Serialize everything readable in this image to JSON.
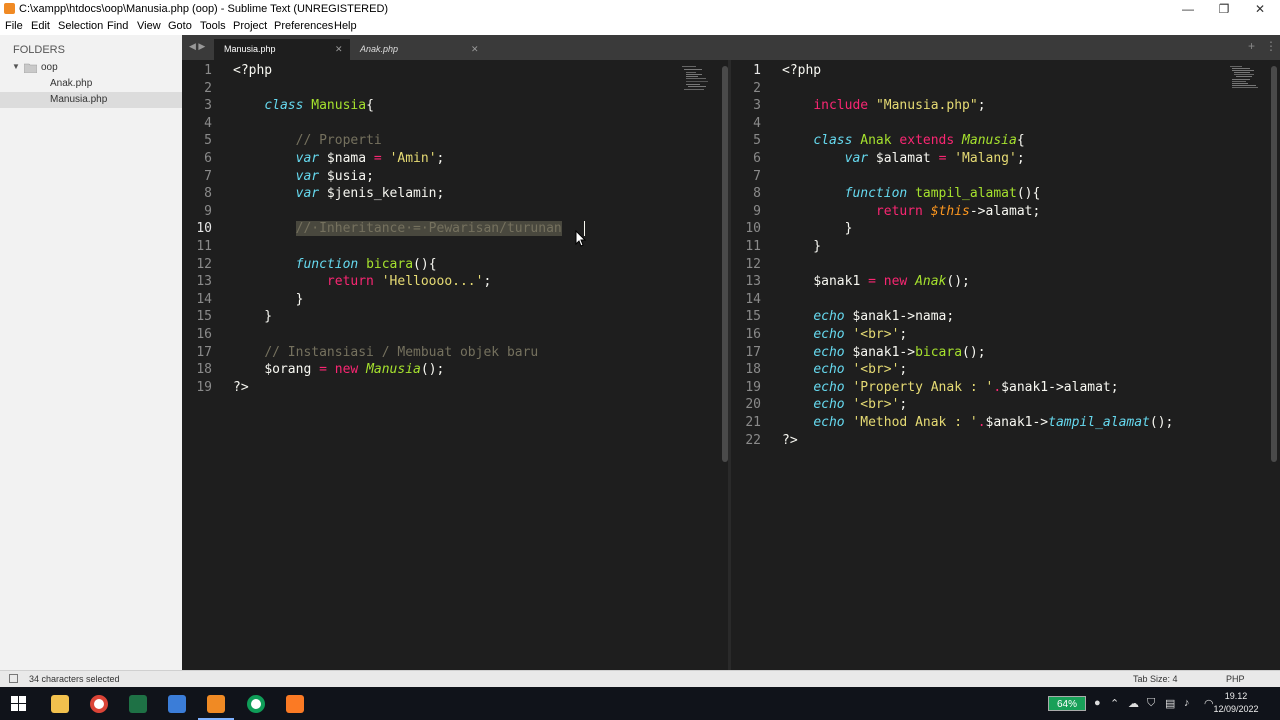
{
  "window": {
    "title": "C:\\xampp\\htdocs\\oop\\Manusia.php (oop) - Sublime Text (UNREGISTERED)",
    "controls": {
      "minimize": "—",
      "restore": "❐",
      "close": "✕"
    }
  },
  "menu": [
    "File",
    "Edit",
    "Selection",
    "Find",
    "View",
    "Goto",
    "Tools",
    "Project",
    "Preferences",
    "Help"
  ],
  "sidebar": {
    "header": "FOLDERS",
    "folder": "oop",
    "files": [
      {
        "name": "Anak.php",
        "selected": false
      },
      {
        "name": "Manusia.php",
        "selected": true
      }
    ]
  },
  "tabs": [
    {
      "label": "Manusia.php",
      "active": true
    },
    {
      "label": "Anak.php",
      "active": false
    }
  ],
  "editor_left": {
    "current_line": 10,
    "lines": [
      [
        [
          "<?php",
          "plain"
        ]
      ],
      [],
      [
        [
          "    ",
          "plain"
        ],
        [
          "class",
          "st"
        ],
        [
          " ",
          "plain"
        ],
        [
          "Manusia",
          "cls"
        ],
        [
          "{",
          "plain"
        ]
      ],
      [],
      [
        [
          "        ",
          "plain"
        ],
        [
          "// Properti",
          "com"
        ]
      ],
      [
        [
          "        ",
          "plain"
        ],
        [
          "var",
          "st"
        ],
        [
          " $nama ",
          "var"
        ],
        [
          "=",
          "op"
        ],
        [
          " ",
          "plain"
        ],
        [
          "'Amin'",
          "str"
        ],
        [
          ";",
          "plain"
        ]
      ],
      [
        [
          "        ",
          "plain"
        ],
        [
          "var",
          "st"
        ],
        [
          " $usia;",
          "var"
        ]
      ],
      [
        [
          "        ",
          "plain"
        ],
        [
          "var",
          "st"
        ],
        [
          " $jenis_kelamin;",
          "var"
        ]
      ],
      [],
      [
        [
          "        ",
          "plain"
        ],
        [
          "//·Inheritance·=·Pewarisan/turunan",
          "sel"
        ]
      ],
      [],
      [
        [
          "        ",
          "plain"
        ],
        [
          "function",
          "st"
        ],
        [
          " ",
          "plain"
        ],
        [
          "bicara",
          "fn"
        ],
        [
          "(){",
          "plain"
        ]
      ],
      [
        [
          "            ",
          "plain"
        ],
        [
          "return",
          "kw"
        ],
        [
          " ",
          "plain"
        ],
        [
          "'Helloooo...'",
          "str"
        ],
        [
          ";",
          "plain"
        ]
      ],
      [
        [
          "        }",
          "plain"
        ]
      ],
      [
        [
          "    }",
          "plain"
        ]
      ],
      [],
      [
        [
          "    ",
          "plain"
        ],
        [
          "// Instansiasi / Membuat objek baru",
          "com"
        ]
      ],
      [
        [
          "    ",
          "plain"
        ],
        [
          "$orang ",
          "var"
        ],
        [
          "=",
          "op"
        ],
        [
          " ",
          "plain"
        ],
        [
          "new",
          "kw"
        ],
        [
          " ",
          "plain"
        ],
        [
          "Manusia",
          "it"
        ],
        [
          "();",
          "plain"
        ]
      ],
      [
        [
          "?>",
          "plain"
        ]
      ]
    ]
  },
  "editor_right": {
    "current_line": 1,
    "lines": [
      [
        [
          "<?php",
          "plain"
        ]
      ],
      [],
      [
        [
          "    ",
          "plain"
        ],
        [
          "include",
          "kw"
        ],
        [
          " ",
          "plain"
        ],
        [
          "\"Manusia.php\"",
          "str"
        ],
        [
          ";",
          "plain"
        ]
      ],
      [],
      [
        [
          "    ",
          "plain"
        ],
        [
          "class",
          "st"
        ],
        [
          " ",
          "plain"
        ],
        [
          "Anak",
          "cls"
        ],
        [
          " ",
          "plain"
        ],
        [
          "extends",
          "kw"
        ],
        [
          " ",
          "plain"
        ],
        [
          "Manusia",
          "it"
        ],
        [
          "{",
          "plain"
        ]
      ],
      [
        [
          "        ",
          "plain"
        ],
        [
          "var",
          "st"
        ],
        [
          " $alamat ",
          "var"
        ],
        [
          "=",
          "op"
        ],
        [
          " ",
          "plain"
        ],
        [
          "'Malang'",
          "str"
        ],
        [
          ";",
          "plain"
        ]
      ],
      [],
      [
        [
          "        ",
          "plain"
        ],
        [
          "function",
          "st"
        ],
        [
          " ",
          "plain"
        ],
        [
          "tampil_alamat",
          "fn"
        ],
        [
          "(){",
          "plain"
        ]
      ],
      [
        [
          "            ",
          "plain"
        ],
        [
          "return",
          "kw"
        ],
        [
          " ",
          "plain"
        ],
        [
          "$this",
          "this"
        ],
        [
          "->alamat;",
          "plain"
        ]
      ],
      [
        [
          "        }",
          "plain"
        ]
      ],
      [
        [
          "    }",
          "plain"
        ]
      ],
      [],
      [
        [
          "    ",
          "plain"
        ],
        [
          "$anak1 ",
          "var"
        ],
        [
          "=",
          "op"
        ],
        [
          " ",
          "plain"
        ],
        [
          "new",
          "kw"
        ],
        [
          " ",
          "plain"
        ],
        [
          "Anak",
          "it"
        ],
        [
          "();",
          "plain"
        ]
      ],
      [],
      [
        [
          "    ",
          "plain"
        ],
        [
          "echo",
          "st"
        ],
        [
          " $anak1->nama;",
          "var"
        ]
      ],
      [
        [
          "    ",
          "plain"
        ],
        [
          "echo",
          "st"
        ],
        [
          " ",
          "plain"
        ],
        [
          "'<br>'",
          "str"
        ],
        [
          ";",
          "plain"
        ]
      ],
      [
        [
          "    ",
          "plain"
        ],
        [
          "echo",
          "st"
        ],
        [
          " $anak1->",
          "var"
        ],
        [
          "bicara",
          "fn"
        ],
        [
          "();",
          "plain"
        ]
      ],
      [
        [
          "    ",
          "plain"
        ],
        [
          "echo",
          "st"
        ],
        [
          " ",
          "plain"
        ],
        [
          "'<br>'",
          "str"
        ],
        [
          ";",
          "plain"
        ]
      ],
      [
        [
          "    ",
          "plain"
        ],
        [
          "echo",
          "st"
        ],
        [
          " ",
          "plain"
        ],
        [
          "'Property Anak : '",
          "str"
        ],
        [
          ".",
          "op"
        ],
        [
          "$anak1->alamat;",
          "var"
        ]
      ],
      [
        [
          "    ",
          "plain"
        ],
        [
          "echo",
          "st"
        ],
        [
          " ",
          "plain"
        ],
        [
          "'<br>'",
          "str"
        ],
        [
          ";",
          "plain"
        ]
      ],
      [
        [
          "    ",
          "plain"
        ],
        [
          "echo",
          "st"
        ],
        [
          " ",
          "plain"
        ],
        [
          "'Method Anak : '",
          "str"
        ],
        [
          ".",
          "op"
        ],
        [
          "$anak1->",
          "var"
        ],
        [
          "tampil_alamat",
          "st"
        ],
        [
          "();",
          "plain"
        ]
      ],
      [
        [
          "?>",
          "plain"
        ]
      ]
    ]
  },
  "status": {
    "selection": "34 characters selected",
    "tab_size": "Tab Size: 4",
    "syntax": "PHP"
  },
  "taskbar": {
    "battery": "64%",
    "time": "19.12",
    "date": "12/09/2022"
  },
  "colors": {
    "editor_bg": "#1e1e1e",
    "keyword": "#f92672",
    "storage": "#66d9ef",
    "function": "#a6e22e",
    "string": "#e6db74",
    "comment": "#75715e"
  }
}
